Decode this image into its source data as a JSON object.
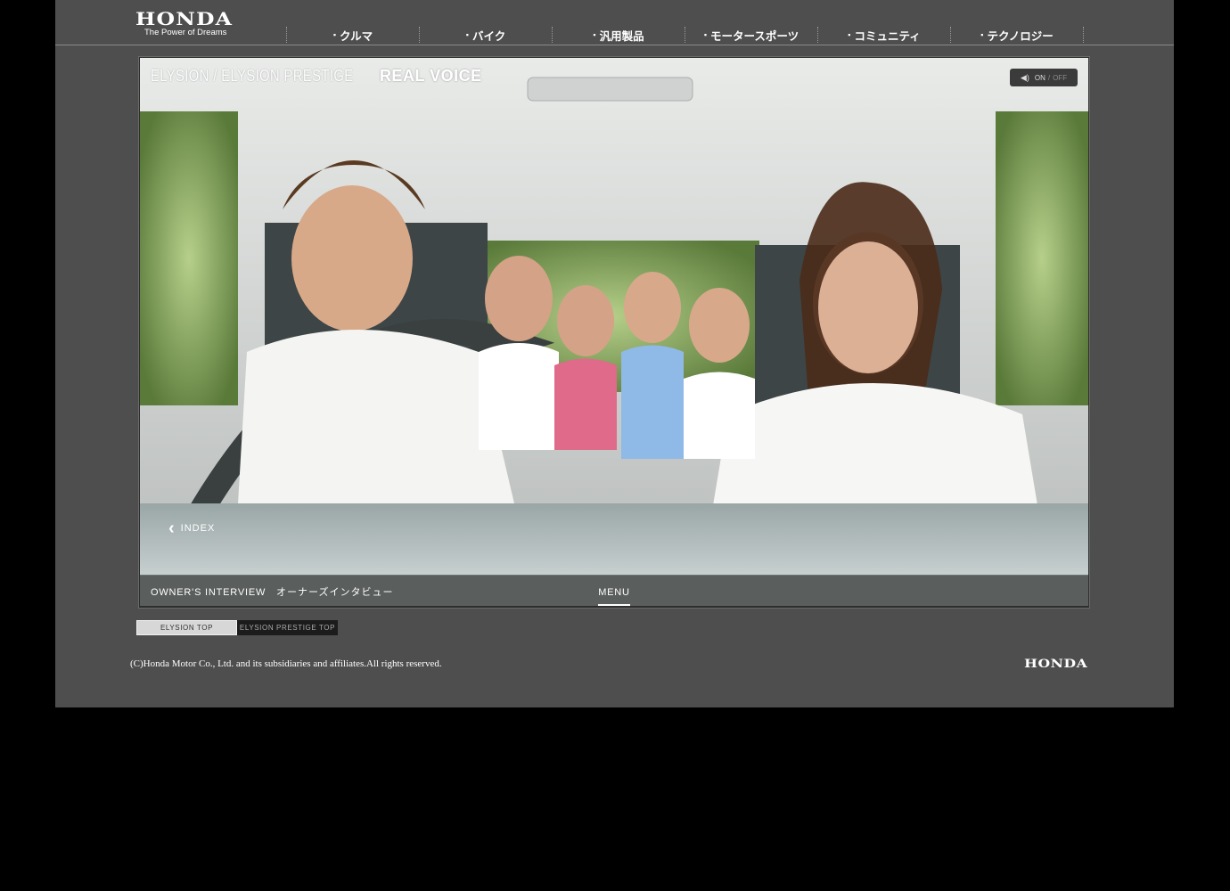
{
  "header": {
    "logo": "HONDA",
    "tagline": "The Power of Dreams",
    "nav": [
      {
        "label": "クルマ"
      },
      {
        "label": "バイク"
      },
      {
        "label": "汎用製品"
      },
      {
        "label": "モータースポーツ"
      },
      {
        "label": "コミュニティ"
      },
      {
        "label": "テクノロジー"
      }
    ]
  },
  "hero": {
    "title_light": "ELYSION / ELYSION PRESTIGE",
    "title_bold": "REAL VOICE",
    "sound": {
      "on": "ON",
      "separator": "/",
      "off": "OFF"
    },
    "index_label": "INDEX",
    "interview_en": "OWNER'S INTERVIEW",
    "interview_jp": "オーナーズインタビュー",
    "menu_label": "MENU"
  },
  "sub_tabs": [
    {
      "label": "ELYSION TOP",
      "active": true
    },
    {
      "label": "ELYSION PRESTIGE TOP",
      "active": false
    }
  ],
  "footer": {
    "copyright": "(C)Honda Motor Co., Ltd. and its subsidiaries and affiliates.All rights reserved.",
    "logo": "HONDA"
  },
  "colors": {
    "page_bg": "#4e4e4e",
    "outer_bg": "#000000",
    "menu_bar": "#5a5e5d"
  }
}
